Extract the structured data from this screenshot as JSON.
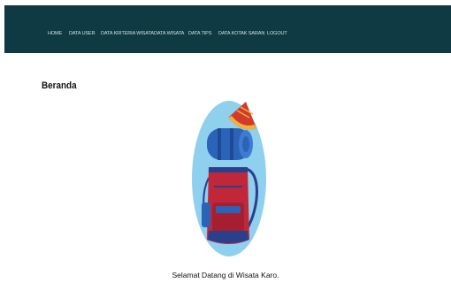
{
  "navbar": {
    "items": [
      {
        "label": "HOME"
      },
      {
        "label": "DATA USER"
      },
      {
        "label": "DATA KRITERIA WISATA"
      },
      {
        "label": "DATA WISATA"
      },
      {
        "label": "DATA TIPS"
      },
      {
        "label": "DATA KOTAK SARAN"
      },
      {
        "label": "LOGOUT"
      }
    ]
  },
  "page": {
    "title": "Beranda",
    "welcome_text": "Selamat Datang di Wisata Karo."
  },
  "illustration": {
    "subject": "backpack-with-hat-icon",
    "colors": {
      "circle": "#8fd0ee",
      "backpack": "#c0283a",
      "roll": "#2b63b8",
      "hat": "#d23a2f",
      "hat_trim": "#f2b233"
    }
  },
  "colors": {
    "navbar": "#0f3a43",
    "nav_text": "#cfe3e6",
    "background": "#ffffff"
  }
}
